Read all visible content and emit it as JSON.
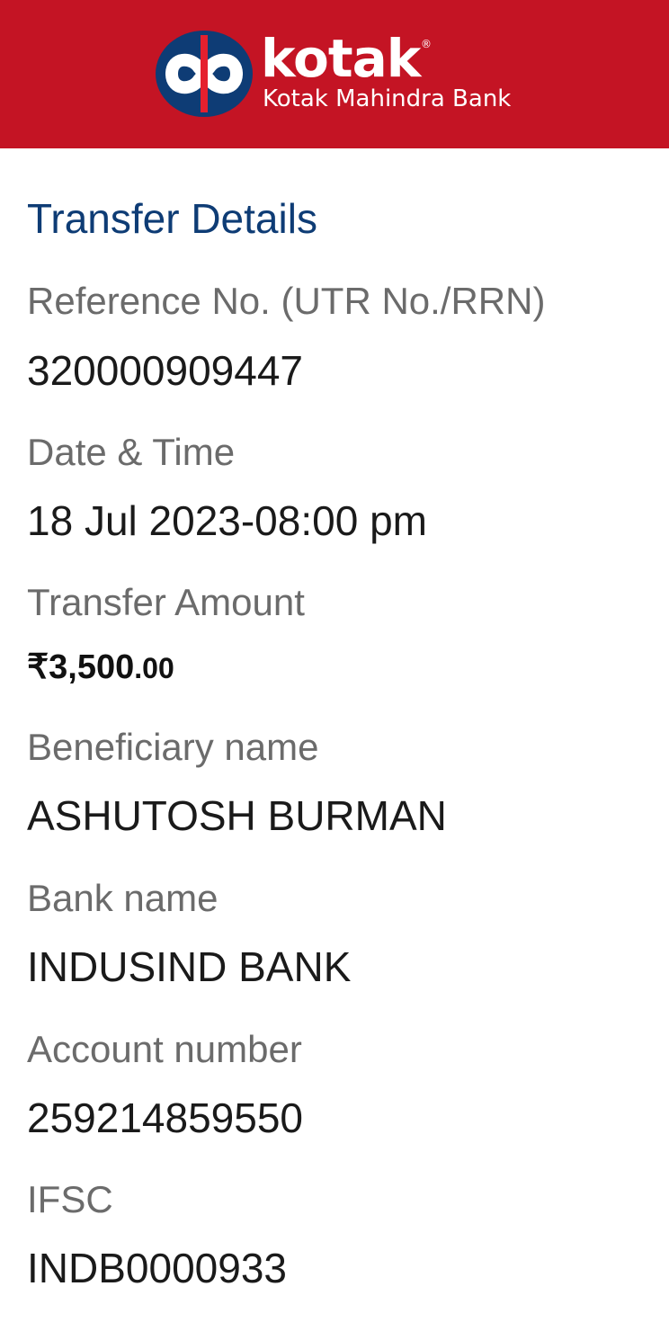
{
  "header": {
    "brand": "kotak",
    "registered_mark": "®",
    "bank_name": "Kotak Mahindra Bank",
    "color": "#c41424"
  },
  "section_title": "Transfer Details",
  "fields": {
    "reference": {
      "label": "Reference No. (UTR No./RRN)",
      "value": "320000909447"
    },
    "datetime": {
      "label": "Date & Time",
      "value": "18 Jul 2023-08:00 pm"
    },
    "amount": {
      "label": "Transfer Amount",
      "value_main": "₹3,500",
      "value_decimal": ".00"
    },
    "beneficiary": {
      "label": "Beneficiary name",
      "value": "ASHUTOSH BURMAN"
    },
    "bank": {
      "label": "Bank name",
      "value": "INDUSIND BANK"
    },
    "account": {
      "label": "Account number",
      "value": "259214859550"
    },
    "ifsc": {
      "label": "IFSC",
      "value": "INDB0000933"
    }
  }
}
